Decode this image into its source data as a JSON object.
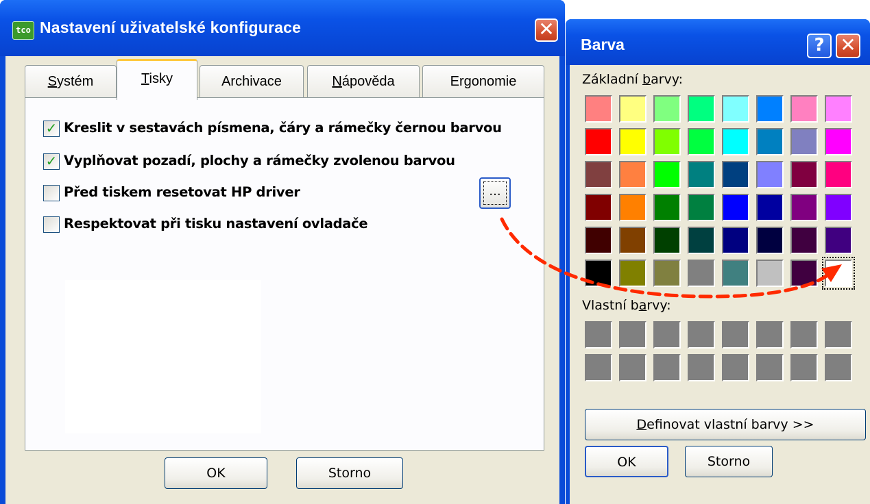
{
  "main_window": {
    "app_icon_text": "tco",
    "title": "Nastavení uživatelské konfigurace",
    "close_glyph": "✕",
    "tabs": [
      {
        "label": "Systém",
        "underline": "S",
        "rest": "ystém"
      },
      {
        "label": "Tisky",
        "underline": "T",
        "rest": "isky"
      },
      {
        "label": "Archivace",
        "underline": "",
        "rest": "Archivace"
      },
      {
        "label": "Nápověda",
        "underline": "N",
        "rest": "ápověda"
      },
      {
        "label": "Ergonomie",
        "underline": "",
        "rest": "Ergonomie"
      }
    ],
    "active_tab": "Tisky",
    "options": [
      {
        "label": "Kreslit v sestavách písmena, čáry a rámečky černou barvou",
        "checked": true,
        "mark": "✓"
      },
      {
        "label": "Vyplňovat pozadí, plochy a rámečky zvolenou barvou",
        "checked": true,
        "mark": "✓"
      },
      {
        "label": "Před tiskem resetovat HP driver",
        "checked": false,
        "mark": ""
      },
      {
        "label": "Respektovat při tisku nastavení ovladače",
        "checked": false,
        "mark": ""
      }
    ],
    "browse_button": "...",
    "ok": "OK",
    "cancel": "Storno"
  },
  "color_dialog": {
    "title": "Barva",
    "help_glyph": "?",
    "close_glyph": "✕",
    "basic_label_pre": "Základní ",
    "basic_label_u": "b",
    "basic_label_post": "arvy:",
    "basic_colors": [
      [
        "#ff8080",
        "#ffff80",
        "#80ff80",
        "#00ff80",
        "#80ffff",
        "#0080ff",
        "#ff80c0",
        "#ff80ff"
      ],
      [
        "#ff0000",
        "#ffff00",
        "#80ff00",
        "#00ff40",
        "#00ffff",
        "#0080c0",
        "#8080c0",
        "#ff00ff"
      ],
      [
        "#804040",
        "#ff8040",
        "#00ff00",
        "#008080",
        "#004080",
        "#8080ff",
        "#800040",
        "#ff0080"
      ],
      [
        "#800000",
        "#ff8000",
        "#008000",
        "#008040",
        "#0000ff",
        "#0000a0",
        "#800080",
        "#8000ff"
      ],
      [
        "#400000",
        "#804000",
        "#004000",
        "#004040",
        "#000080",
        "#000040",
        "#400040",
        "#400080"
      ],
      [
        "#000000",
        "#808000",
        "#808040",
        "#808080",
        "#408080",
        "#c0c0c0",
        "#400040",
        "#ffffff"
      ]
    ],
    "selected": "#ffffff",
    "custom_label_pre": "Vlastní b",
    "custom_label_u": "a",
    "custom_label_post": "rvy:",
    "custom_color": "#808080",
    "define_pre": "",
    "define_u": "D",
    "define_post": "efinovat vlastní barvy >>",
    "ok": "OK",
    "cancel": "Storno"
  },
  "colors": {
    "title_blue": "#0a52e6",
    "face": "#ece9d8",
    "arrow": "#ff2a00",
    "check": "#21a121"
  }
}
